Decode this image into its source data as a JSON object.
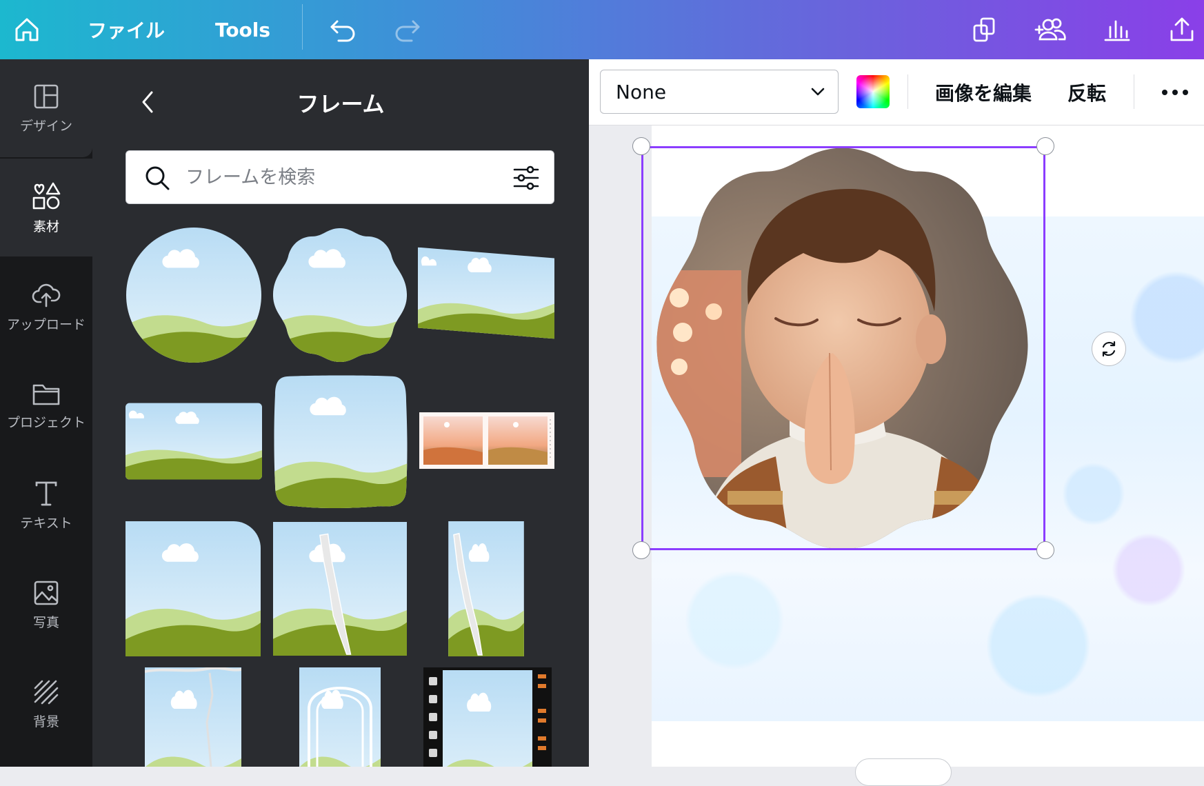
{
  "topbar": {
    "file_label": "ファイル",
    "tools_label": "Tools"
  },
  "rail": {
    "items": [
      {
        "label": "デザイン",
        "icon": "layout-icon"
      },
      {
        "label": "素材",
        "icon": "elements-icon"
      },
      {
        "label": "アップロード",
        "icon": "upload-cloud-icon"
      },
      {
        "label": "プロジェクト",
        "icon": "folder-icon"
      },
      {
        "label": "テキスト",
        "icon": "text-icon"
      },
      {
        "label": "写真",
        "icon": "photo-icon"
      },
      {
        "label": "背景",
        "icon": "background-icon"
      }
    ]
  },
  "panel": {
    "title": "フレーム",
    "search_placeholder": "フレームを検索"
  },
  "toolbar": {
    "filter_value": "None",
    "edit_image_label": "画像を編集",
    "flip_label": "反転"
  },
  "colors": {
    "accent": "#8b3dff",
    "rail_bg": "#18191b",
    "panel_bg": "#2a2c30",
    "sky": "#cfe6f7",
    "grass_light": "#c2dc8e",
    "grass_dark": "#7e9a22"
  }
}
